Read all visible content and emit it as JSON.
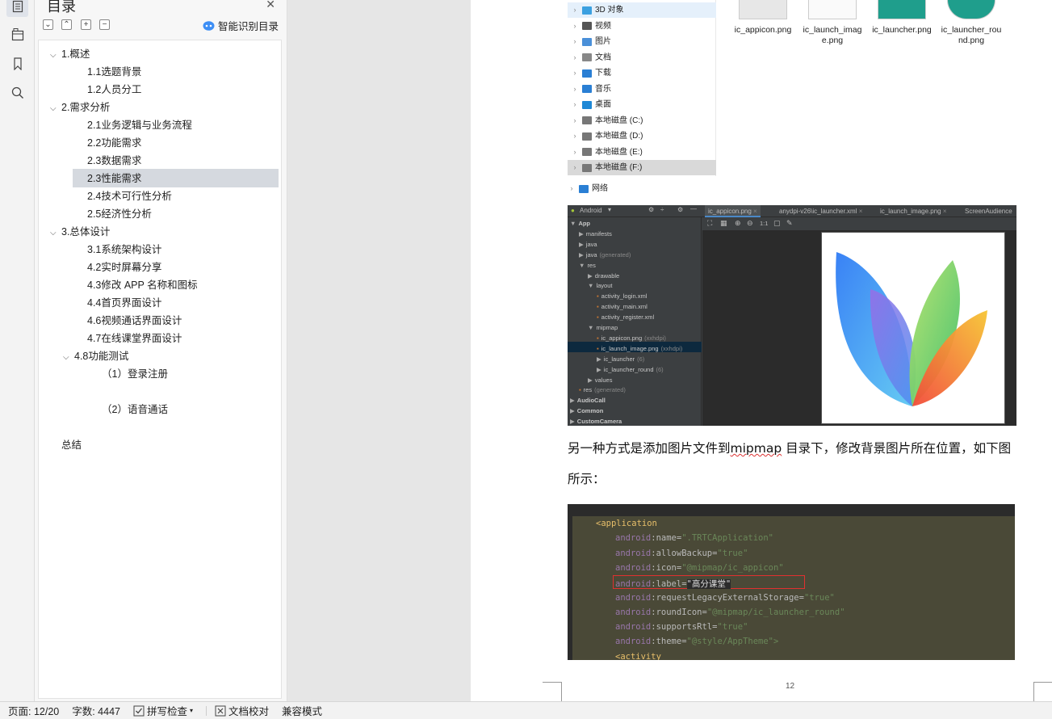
{
  "rail": {
    "icons": [
      "toc-icon",
      "navigation-icon",
      "bookmark-icon",
      "search-icon"
    ]
  },
  "toc": {
    "title": "目录",
    "smart_label": "智能识别目录",
    "items": [
      {
        "label": "1.概述",
        "level": 1,
        "expanded": true
      },
      {
        "label": "1.1选题背景",
        "level": 2
      },
      {
        "label": "1.2人员分工",
        "level": 2
      },
      {
        "label": "2.需求分析",
        "level": 1,
        "expanded": true
      },
      {
        "label": "2.1业务逻辑与业务流程",
        "level": 2
      },
      {
        "label": "2.2功能需求",
        "level": 2
      },
      {
        "label": "2.3数据需求",
        "level": 2
      },
      {
        "label": "2.3性能需求",
        "level": 2,
        "selected": true
      },
      {
        "label": "2.4技术可行性分析",
        "level": 2
      },
      {
        "label": "2.5经济性分析",
        "level": 2
      },
      {
        "label": "3.总体设计",
        "level": 1,
        "expanded": true
      },
      {
        "label": "3.1系统架构设计",
        "level": 2
      },
      {
        "label": "4.2实时屏幕分享",
        "level": 2
      },
      {
        "label": "4.3修改 APP 名称和图标",
        "level": 2
      },
      {
        "label": "4.4首页界面设计",
        "level": 2
      },
      {
        "label": "4.6视频通话界面设计",
        "level": 2
      },
      {
        "label": "4.7在线课堂界面设计",
        "level": 2
      },
      {
        "label": "4.8功能测试",
        "level": 2,
        "expanded": true
      },
      {
        "label": "（1）登录注册",
        "level": 3
      },
      {
        "label": "（2）语音通话",
        "level": 3
      },
      {
        "label": "总结",
        "level": 1
      }
    ]
  },
  "explorer": {
    "tree": [
      {
        "label": "3D 对象",
        "icon": "3d-objects-icon",
        "color": "#3ba0e0"
      },
      {
        "label": "视频",
        "icon": "video-icon",
        "color": "#555"
      },
      {
        "label": "图片",
        "icon": "pictures-icon",
        "color": "#4a90d9"
      },
      {
        "label": "文档",
        "icon": "documents-icon",
        "color": "#888"
      },
      {
        "label": "下载",
        "icon": "download-icon",
        "color": "#2a7fd4"
      },
      {
        "label": "音乐",
        "icon": "music-icon",
        "color": "#2a7fd4"
      },
      {
        "label": "桌面",
        "icon": "desktop-icon",
        "color": "#1e88d6"
      },
      {
        "label": "本地磁盘 (C:)",
        "icon": "drive-icon",
        "color": "#777"
      },
      {
        "label": "本地磁盘 (D:)",
        "icon": "drive-icon",
        "color": "#777"
      },
      {
        "label": "本地磁盘 (E:)",
        "icon": "drive-icon",
        "color": "#777"
      },
      {
        "label": "本地磁盘 (F:)",
        "icon": "drive-icon",
        "color": "#777"
      },
      {
        "label": "网络",
        "icon": "network-icon",
        "color": "#2a7fd4"
      }
    ],
    "files": [
      {
        "line1": "ic_appicon.png",
        "line2": ""
      },
      {
        "line1": "ic_launch_imag",
        "line2": "e.png"
      },
      {
        "line1": "ic_launcher.png",
        "line2": ""
      },
      {
        "line1": "ic_launcher_rou",
        "line2": "nd.png"
      }
    ]
  },
  "studio": {
    "project_view": "Android",
    "tabs": [
      "ic_appicon.png",
      "anydpi-v26\\ic_launcher.xml",
      "ic_launch_image.png",
      "ScreenAudience"
    ],
    "tree": [
      {
        "label": "App",
        "indent": 0,
        "tri": "▼",
        "bold": true
      },
      {
        "label": "manifests",
        "indent": 1,
        "tri": "▶"
      },
      {
        "label": "java",
        "indent": 1,
        "tri": "▶"
      },
      {
        "label": "java",
        "dim": "(generated)",
        "indent": 1,
        "tri": "▶"
      },
      {
        "label": "res",
        "indent": 1,
        "tri": "▼"
      },
      {
        "label": "drawable",
        "indent": 2,
        "tri": "▶"
      },
      {
        "label": "layout",
        "indent": 2,
        "tri": "▼"
      },
      {
        "label": "activity_login.xml",
        "indent": 3,
        "tri": ""
      },
      {
        "label": "activity_main.xml",
        "indent": 3,
        "tri": ""
      },
      {
        "label": "activity_register.xml",
        "indent": 3,
        "tri": ""
      },
      {
        "label": "mipmap",
        "indent": 2,
        "tri": "▼"
      },
      {
        "label": "ic_appicon.png",
        "dim": "(xxhdpi)",
        "indent": 3,
        "tri": ""
      },
      {
        "label": "ic_launch_image.png",
        "dim": "(xxhdpi)",
        "indent": 3,
        "tri": ""
      },
      {
        "label": "ic_launcher",
        "dim": "(6)",
        "indent": 3,
        "tri": "▶"
      },
      {
        "label": "ic_launcher_round",
        "dim": "(6)",
        "indent": 3,
        "tri": "▶"
      },
      {
        "label": "values",
        "indent": 2,
        "tri": "▶"
      },
      {
        "label": "res",
        "dim": "(generated)",
        "indent": 1,
        "tri": ""
      },
      {
        "label": "AudioCall",
        "indent": 0,
        "tri": "▶",
        "bold": true
      },
      {
        "label": "Common",
        "indent": 0,
        "tri": "▶",
        "bold": true
      },
      {
        "label": "CustomCamera",
        "indent": 0,
        "tri": "▶",
        "bold": true
      }
    ],
    "zoom_label": "1:1"
  },
  "doc": {
    "para_before": "另一种方式是添加图片文件到",
    "para_word": "mipmap",
    "para_after": " 目录下，修改背景图片所在位置，如下图",
    "para_line2": "所示："
  },
  "code": {
    "lines": [
      {
        "type": "tag",
        "text": "<application"
      },
      {
        "attr": "name",
        "value": "\".TRTCApplication\""
      },
      {
        "attr": "allowBackup",
        "value": "\"true\""
      },
      {
        "attr": "icon",
        "value": "\"@mipmap/ic_appicon\""
      },
      {
        "attr": "label",
        "value": "\"高分课堂\""
      },
      {
        "attr": "requestLegacyExternalStorage",
        "value": "\"true\""
      },
      {
        "attr": "roundIcon",
        "value": "\"@mipmap/ic_launcher_round\""
      },
      {
        "attr": "supportsRtl",
        "value": "\"true\""
      },
      {
        "attr": "theme",
        "value": "\"@style/AppTheme\">"
      },
      {
        "type": "tag2",
        "text": "<activity"
      }
    ],
    "ns": "android",
    "tag_name": "application"
  },
  "page_number": "12",
  "status": {
    "page": "页面: 12/20",
    "words": "字数: 4447",
    "spell": "拼写检查",
    "proof": "文档校对",
    "compat": "兼容模式"
  }
}
